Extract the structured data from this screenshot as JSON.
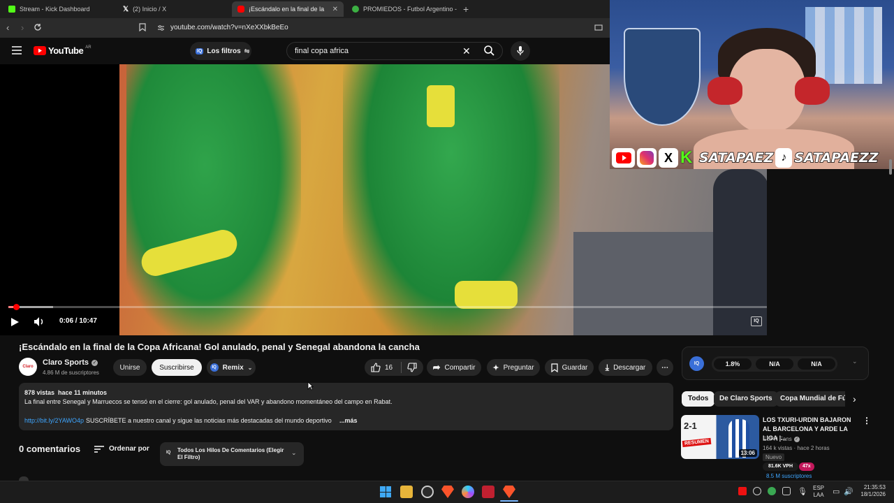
{
  "browser": {
    "tabs": [
      {
        "title": "Stream - Kick Dashboard",
        "favicon_color": "#53fc18"
      },
      {
        "title": "(2) Inicio / X",
        "favicon_color": "#ffffff"
      },
      {
        "title": "¡Escándalo en la final de la Copa",
        "favicon_color": "#ff0000"
      },
      {
        "title": "PROMIEDOS - Futbol Argentino - Fú",
        "favicon_color": "#3cb043"
      }
    ],
    "new_tab_icon": "plus-icon",
    "url": "youtube.com/watch?v=nXeXXbkBeEo"
  },
  "youtube": {
    "logo_text": "YouTube",
    "country_code": "AR",
    "filters_label": "Los filtros",
    "search_value": "final copa africa",
    "accent": "#ff0000"
  },
  "player": {
    "time": "0:06 / 10:47",
    "progress_fraction": 0.009
  },
  "stream_overlay": {
    "handle_1": "SATAPAEZ",
    "handle_2": "SATAPAEZZ"
  },
  "video": {
    "title": "¡Escándalo en la final de la Copa Africana! Gol anulado, penal y Senegal abandona la cancha",
    "channel": "Claro Sports",
    "subscribers": "4.86 M de suscriptores",
    "join_label": "Unirse",
    "subscribe_label": "Suscribirse",
    "remix_label": "Remix",
    "likes": "16",
    "share_label": "Compartir",
    "ask_label": "Preguntar",
    "save_label": "Guardar",
    "download_label": "Descargar",
    "views_line": "878 vistas  hace 11 minutos",
    "description": "La final entre Senegal y Marruecos se tensó en el cierre: gol anulado, penal del VAR y abandono momentáneo del campo en Rabat.",
    "desc_link": "http://bit.ly/2YAWO4p",
    "desc_more_text": "SUSCRÍBETE a nuestro canal y sigue las noticias más destacadas del mundo deportivo",
    "more_label": "...más"
  },
  "comments": {
    "count_label": "0 comentarios",
    "sort_label": "Ordenar por",
    "filter_label": "Todos Los Hilos De Comentarios (Elegir El Filtro)"
  },
  "sidebar": {
    "stats": [
      "1.8%",
      "N/A",
      "N/A"
    ],
    "chips": [
      "Todos",
      "De Claro Sports",
      "Copa Mundial de Fútb"
    ],
    "reco": {
      "title": "LOS TXURI-URDIN BAJARON AL BARCELONA Y ARDE LA LIGA |...",
      "channel": "ESPN Fans",
      "meta": "164 k vistas · hace 2 horas",
      "badge": "Nuevo",
      "duration": "13:06",
      "thumb_score": "2-1",
      "thumb_label": "RESUMEN",
      "vph": "81.6K VPH",
      "mult": "47x",
      "subs": "8.5 M suscriptores"
    }
  },
  "taskbar": {
    "lang_1": "ESP",
    "lang_2": "LAA",
    "time": "21:35:53",
    "date": "18/1/2026"
  }
}
